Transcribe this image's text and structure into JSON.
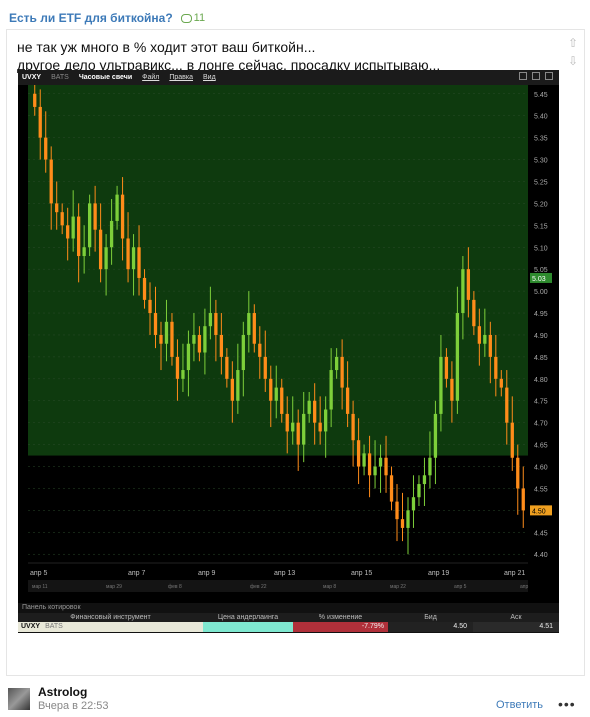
{
  "topic": {
    "title": "Есть ли ETF для биткойна?",
    "comments": "11"
  },
  "post": {
    "lines": [
      "не так уж много в % ходит этот ваш биткойн...",
      "другое дело ультравикс... в лонге сейчас, просадку испытываю..."
    ]
  },
  "window": {
    "symbol": "UVXY",
    "exchange": "BATS",
    "timeframe": "Часовые свечи",
    "menu": [
      "Файл",
      "Правка",
      "Вид"
    ]
  },
  "chart_data": {
    "type": "candlestick",
    "title": "",
    "y_ticks": [
      "5.45",
      "5.40",
      "5.35",
      "5.30",
      "5.25",
      "5.20",
      "5.15",
      "5.10",
      "5.05",
      "5.00",
      "4.95",
      "4.90",
      "4.85",
      "4.80",
      "4.75",
      "4.70",
      "4.65",
      "4.60",
      "4.55",
      "4.50",
      "4.45",
      "4.40"
    ],
    "x_ticks": [
      "апр 5",
      "апр 7",
      "апр 9",
      "апр 13",
      "апр 15",
      "апр 19",
      "апр 21"
    ],
    "x_ticks_small": [
      "мар 11",
      "мар 29",
      "фев 8",
      "фев 22",
      "мар 8",
      "мар 22",
      "апр 5",
      "апр"
    ],
    "ylim": [
      4.38,
      5.47
    ],
    "last_price": "4.50",
    "marker_price": "5.03",
    "green_zone_low": 4.625,
    "closes": [
      5.42,
      5.35,
      5.3,
      5.2,
      5.18,
      5.15,
      5.12,
      5.17,
      5.08,
      5.1,
      5.2,
      5.14,
      5.05,
      5.1,
      5.16,
      5.22,
      5.12,
      5.05,
      5.1,
      5.03,
      4.98,
      4.95,
      4.9,
      4.88,
      4.93,
      4.85,
      4.8,
      4.82,
      4.88,
      4.9,
      4.86,
      4.92,
      4.95,
      4.9,
      4.85,
      4.8,
      4.75,
      4.82,
      4.9,
      4.95,
      4.88,
      4.85,
      4.8,
      4.75,
      4.78,
      4.72,
      4.68,
      4.7,
      4.65,
      4.72,
      4.75,
      4.7,
      4.68,
      4.73,
      4.82,
      4.85,
      4.78,
      4.72,
      4.66,
      4.6,
      4.63,
      4.58,
      4.6,
      4.62,
      4.58,
      4.52,
      4.48,
      4.46,
      4.5,
      4.53,
      4.56,
      4.58,
      4.62,
      4.72,
      4.85,
      4.8,
      4.75,
      4.95,
      5.05,
      4.98,
      4.92,
      4.88,
      4.9,
      4.85,
      4.8,
      4.78,
      4.7,
      4.62,
      4.55,
      4.5
    ]
  },
  "panel": {
    "title": "Панель котировок",
    "headers": [
      "Финансовый инструмент",
      "Цена андерлаинга",
      "% изменение",
      "Бид",
      "Аск"
    ],
    "row": {
      "symbol": "UVXY",
      "exchange": "BATS",
      "change": "-7.79%",
      "bid": "4.50",
      "ask": "4.51"
    }
  },
  "comment": {
    "author": "Astrolog",
    "time": "Вчера в 22:53",
    "reply": "Ответить",
    "more": "•••"
  },
  "colors": {
    "accent": "#3d7ab8",
    "up": "#7dcf3a",
    "down": "#ff8c1a",
    "zone": "#0e3a0e"
  }
}
